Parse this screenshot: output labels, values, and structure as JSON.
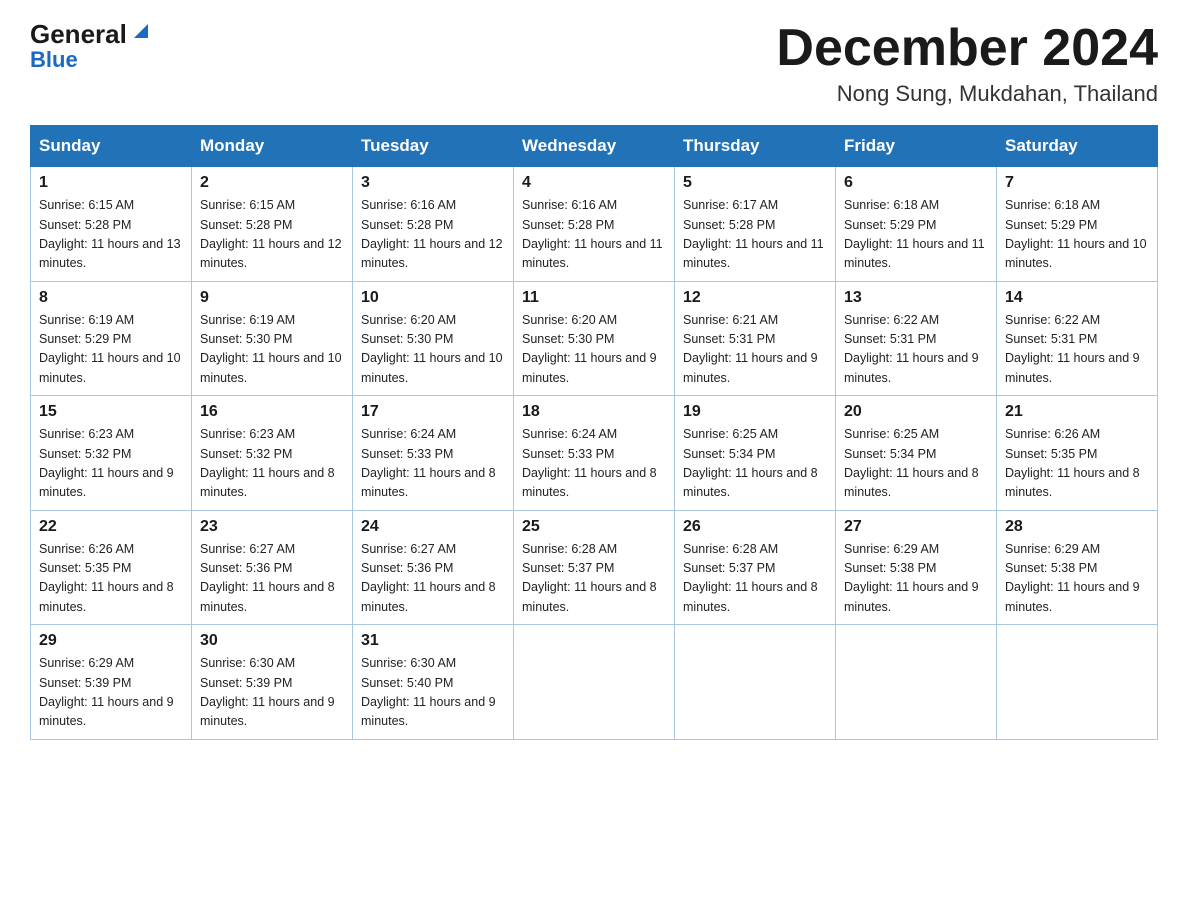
{
  "header": {
    "logo_general": "General",
    "logo_blue": "Blue",
    "month_title": "December 2024",
    "location": "Nong Sung, Mukdahan, Thailand"
  },
  "days_of_week": [
    "Sunday",
    "Monday",
    "Tuesday",
    "Wednesday",
    "Thursday",
    "Friday",
    "Saturday"
  ],
  "weeks": [
    [
      {
        "day": "1",
        "sunrise": "6:15 AM",
        "sunset": "5:28 PM",
        "daylight": "11 hours and 13 minutes."
      },
      {
        "day": "2",
        "sunrise": "6:15 AM",
        "sunset": "5:28 PM",
        "daylight": "11 hours and 12 minutes."
      },
      {
        "day": "3",
        "sunrise": "6:16 AM",
        "sunset": "5:28 PM",
        "daylight": "11 hours and 12 minutes."
      },
      {
        "day": "4",
        "sunrise": "6:16 AM",
        "sunset": "5:28 PM",
        "daylight": "11 hours and 11 minutes."
      },
      {
        "day": "5",
        "sunrise": "6:17 AM",
        "sunset": "5:28 PM",
        "daylight": "11 hours and 11 minutes."
      },
      {
        "day": "6",
        "sunrise": "6:18 AM",
        "sunset": "5:29 PM",
        "daylight": "11 hours and 11 minutes."
      },
      {
        "day": "7",
        "sunrise": "6:18 AM",
        "sunset": "5:29 PM",
        "daylight": "11 hours and 10 minutes."
      }
    ],
    [
      {
        "day": "8",
        "sunrise": "6:19 AM",
        "sunset": "5:29 PM",
        "daylight": "11 hours and 10 minutes."
      },
      {
        "day": "9",
        "sunrise": "6:19 AM",
        "sunset": "5:30 PM",
        "daylight": "11 hours and 10 minutes."
      },
      {
        "day": "10",
        "sunrise": "6:20 AM",
        "sunset": "5:30 PM",
        "daylight": "11 hours and 10 minutes."
      },
      {
        "day": "11",
        "sunrise": "6:20 AM",
        "sunset": "5:30 PM",
        "daylight": "11 hours and 9 minutes."
      },
      {
        "day": "12",
        "sunrise": "6:21 AM",
        "sunset": "5:31 PM",
        "daylight": "11 hours and 9 minutes."
      },
      {
        "day": "13",
        "sunrise": "6:22 AM",
        "sunset": "5:31 PM",
        "daylight": "11 hours and 9 minutes."
      },
      {
        "day": "14",
        "sunrise": "6:22 AM",
        "sunset": "5:31 PM",
        "daylight": "11 hours and 9 minutes."
      }
    ],
    [
      {
        "day": "15",
        "sunrise": "6:23 AM",
        "sunset": "5:32 PM",
        "daylight": "11 hours and 9 minutes."
      },
      {
        "day": "16",
        "sunrise": "6:23 AM",
        "sunset": "5:32 PM",
        "daylight": "11 hours and 8 minutes."
      },
      {
        "day": "17",
        "sunrise": "6:24 AM",
        "sunset": "5:33 PM",
        "daylight": "11 hours and 8 minutes."
      },
      {
        "day": "18",
        "sunrise": "6:24 AM",
        "sunset": "5:33 PM",
        "daylight": "11 hours and 8 minutes."
      },
      {
        "day": "19",
        "sunrise": "6:25 AM",
        "sunset": "5:34 PM",
        "daylight": "11 hours and 8 minutes."
      },
      {
        "day": "20",
        "sunrise": "6:25 AM",
        "sunset": "5:34 PM",
        "daylight": "11 hours and 8 minutes."
      },
      {
        "day": "21",
        "sunrise": "6:26 AM",
        "sunset": "5:35 PM",
        "daylight": "11 hours and 8 minutes."
      }
    ],
    [
      {
        "day": "22",
        "sunrise": "6:26 AM",
        "sunset": "5:35 PM",
        "daylight": "11 hours and 8 minutes."
      },
      {
        "day": "23",
        "sunrise": "6:27 AM",
        "sunset": "5:36 PM",
        "daylight": "11 hours and 8 minutes."
      },
      {
        "day": "24",
        "sunrise": "6:27 AM",
        "sunset": "5:36 PM",
        "daylight": "11 hours and 8 minutes."
      },
      {
        "day": "25",
        "sunrise": "6:28 AM",
        "sunset": "5:37 PM",
        "daylight": "11 hours and 8 minutes."
      },
      {
        "day": "26",
        "sunrise": "6:28 AM",
        "sunset": "5:37 PM",
        "daylight": "11 hours and 8 minutes."
      },
      {
        "day": "27",
        "sunrise": "6:29 AM",
        "sunset": "5:38 PM",
        "daylight": "11 hours and 9 minutes."
      },
      {
        "day": "28",
        "sunrise": "6:29 AM",
        "sunset": "5:38 PM",
        "daylight": "11 hours and 9 minutes."
      }
    ],
    [
      {
        "day": "29",
        "sunrise": "6:29 AM",
        "sunset": "5:39 PM",
        "daylight": "11 hours and 9 minutes."
      },
      {
        "day": "30",
        "sunrise": "6:30 AM",
        "sunset": "5:39 PM",
        "daylight": "11 hours and 9 minutes."
      },
      {
        "day": "31",
        "sunrise": "6:30 AM",
        "sunset": "5:40 PM",
        "daylight": "11 hours and 9 minutes."
      },
      null,
      null,
      null,
      null
    ]
  ]
}
